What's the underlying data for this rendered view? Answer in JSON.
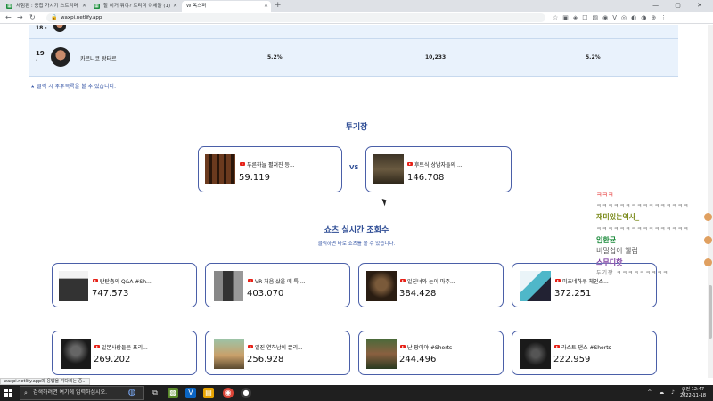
{
  "browser": {
    "tabs": [
      {
        "label": "체험판 : 종합 가시기 스트리머",
        "favicon": "sheets"
      },
      {
        "label": "할 이거 뭐야? 트리미 이세돌 (1)",
        "favicon": "sheets"
      },
      {
        "label": "W  옥스퍼",
        "favicon": "w"
      }
    ],
    "url": "waxpi.netlify.app",
    "new_tab": "+",
    "window_controls": "— ▢ ✕"
  },
  "table": {
    "rows": [
      {
        "rank": "18\n·",
        "name": "",
        "pct1": "",
        "count": "",
        "pct2": ""
      },
      {
        "rank": "19\n·",
        "name": "카르니코 왕터르",
        "pct1": "5.2%",
        "count": "10,233",
        "pct2": "5.2%"
      }
    ],
    "note": "★ 클릭 시 주주목록을 볼 수 있습니다."
  },
  "arena": {
    "title": "투기장",
    "vs_label": "VS",
    "left": {
      "title": "푸른하늘 펼쳐진 등...",
      "count": "59.119"
    },
    "right": {
      "title": "후트식 상남자들의 ...",
      "count": "146.708"
    }
  },
  "shorts": {
    "title": "쇼츠 실시간 조회수",
    "subtitle": "클릭하면 바로 쇼츠를 볼 수 있습니다.",
    "items": [
      {
        "title": "탄탄충의 Q&A #Sh...",
        "count": "747.573"
      },
      {
        "title": "VR 처음 샀을 때 특 ...",
        "count": "403.070"
      },
      {
        "title": "일진녀와 눈이 마주...",
        "count": "384.428"
      },
      {
        "title": "미츠네하쿠 체인소...",
        "count": "372.251"
      },
      {
        "title": "일본사람들은 프리...",
        "count": "269.202"
      },
      {
        "title": "일진 연하남이 끌리...",
        "count": "256.928"
      },
      {
        "title": "난 팡이야 #Shorts",
        "count": "244.496"
      },
      {
        "title": "라스트 댄스 #Shorts",
        "count": "222.959"
      }
    ]
  },
  "chat": {
    "lines": [
      {
        "text": "ㅋㅋㅋ",
        "color": "#e77"
      },
      {
        "text": "ㅋㅋㅋㅋㅋㅋㅋㅋㅋㅋㅋㅋㅋㅋㅋㅋ",
        "color": "#777"
      },
      {
        "text": "재미있는역사_",
        "color": "#7a8a1a"
      },
      {
        "text": "ㅋㅋㅋㅋㅋㅋㅋㅋㅋㅋㅋㅋㅋㅋㅋㅋ",
        "color": "#777"
      },
      {
        "text": "임환균",
        "color": "#1a8a3a"
      },
      {
        "text": "비밀쉽이 웰컴",
        "color": "#555"
      },
      {
        "text": "스무디핫",
        "color": "#7a3aa0"
      },
      {
        "text": "두기장 ㅋㅋㅋㅋㅋㅋㅋㅋㅋ",
        "color": "#777"
      }
    ]
  },
  "status": {
    "text": "waxpi.netlify.app의 응답을 기다리는 중..."
  },
  "taskbar": {
    "search_placeholder": "검색하려면 여기에 입력하십시오.",
    "tray": "^ ☁ ♪ A",
    "time": "오전 12:47",
    "date": "2022-11-18"
  }
}
